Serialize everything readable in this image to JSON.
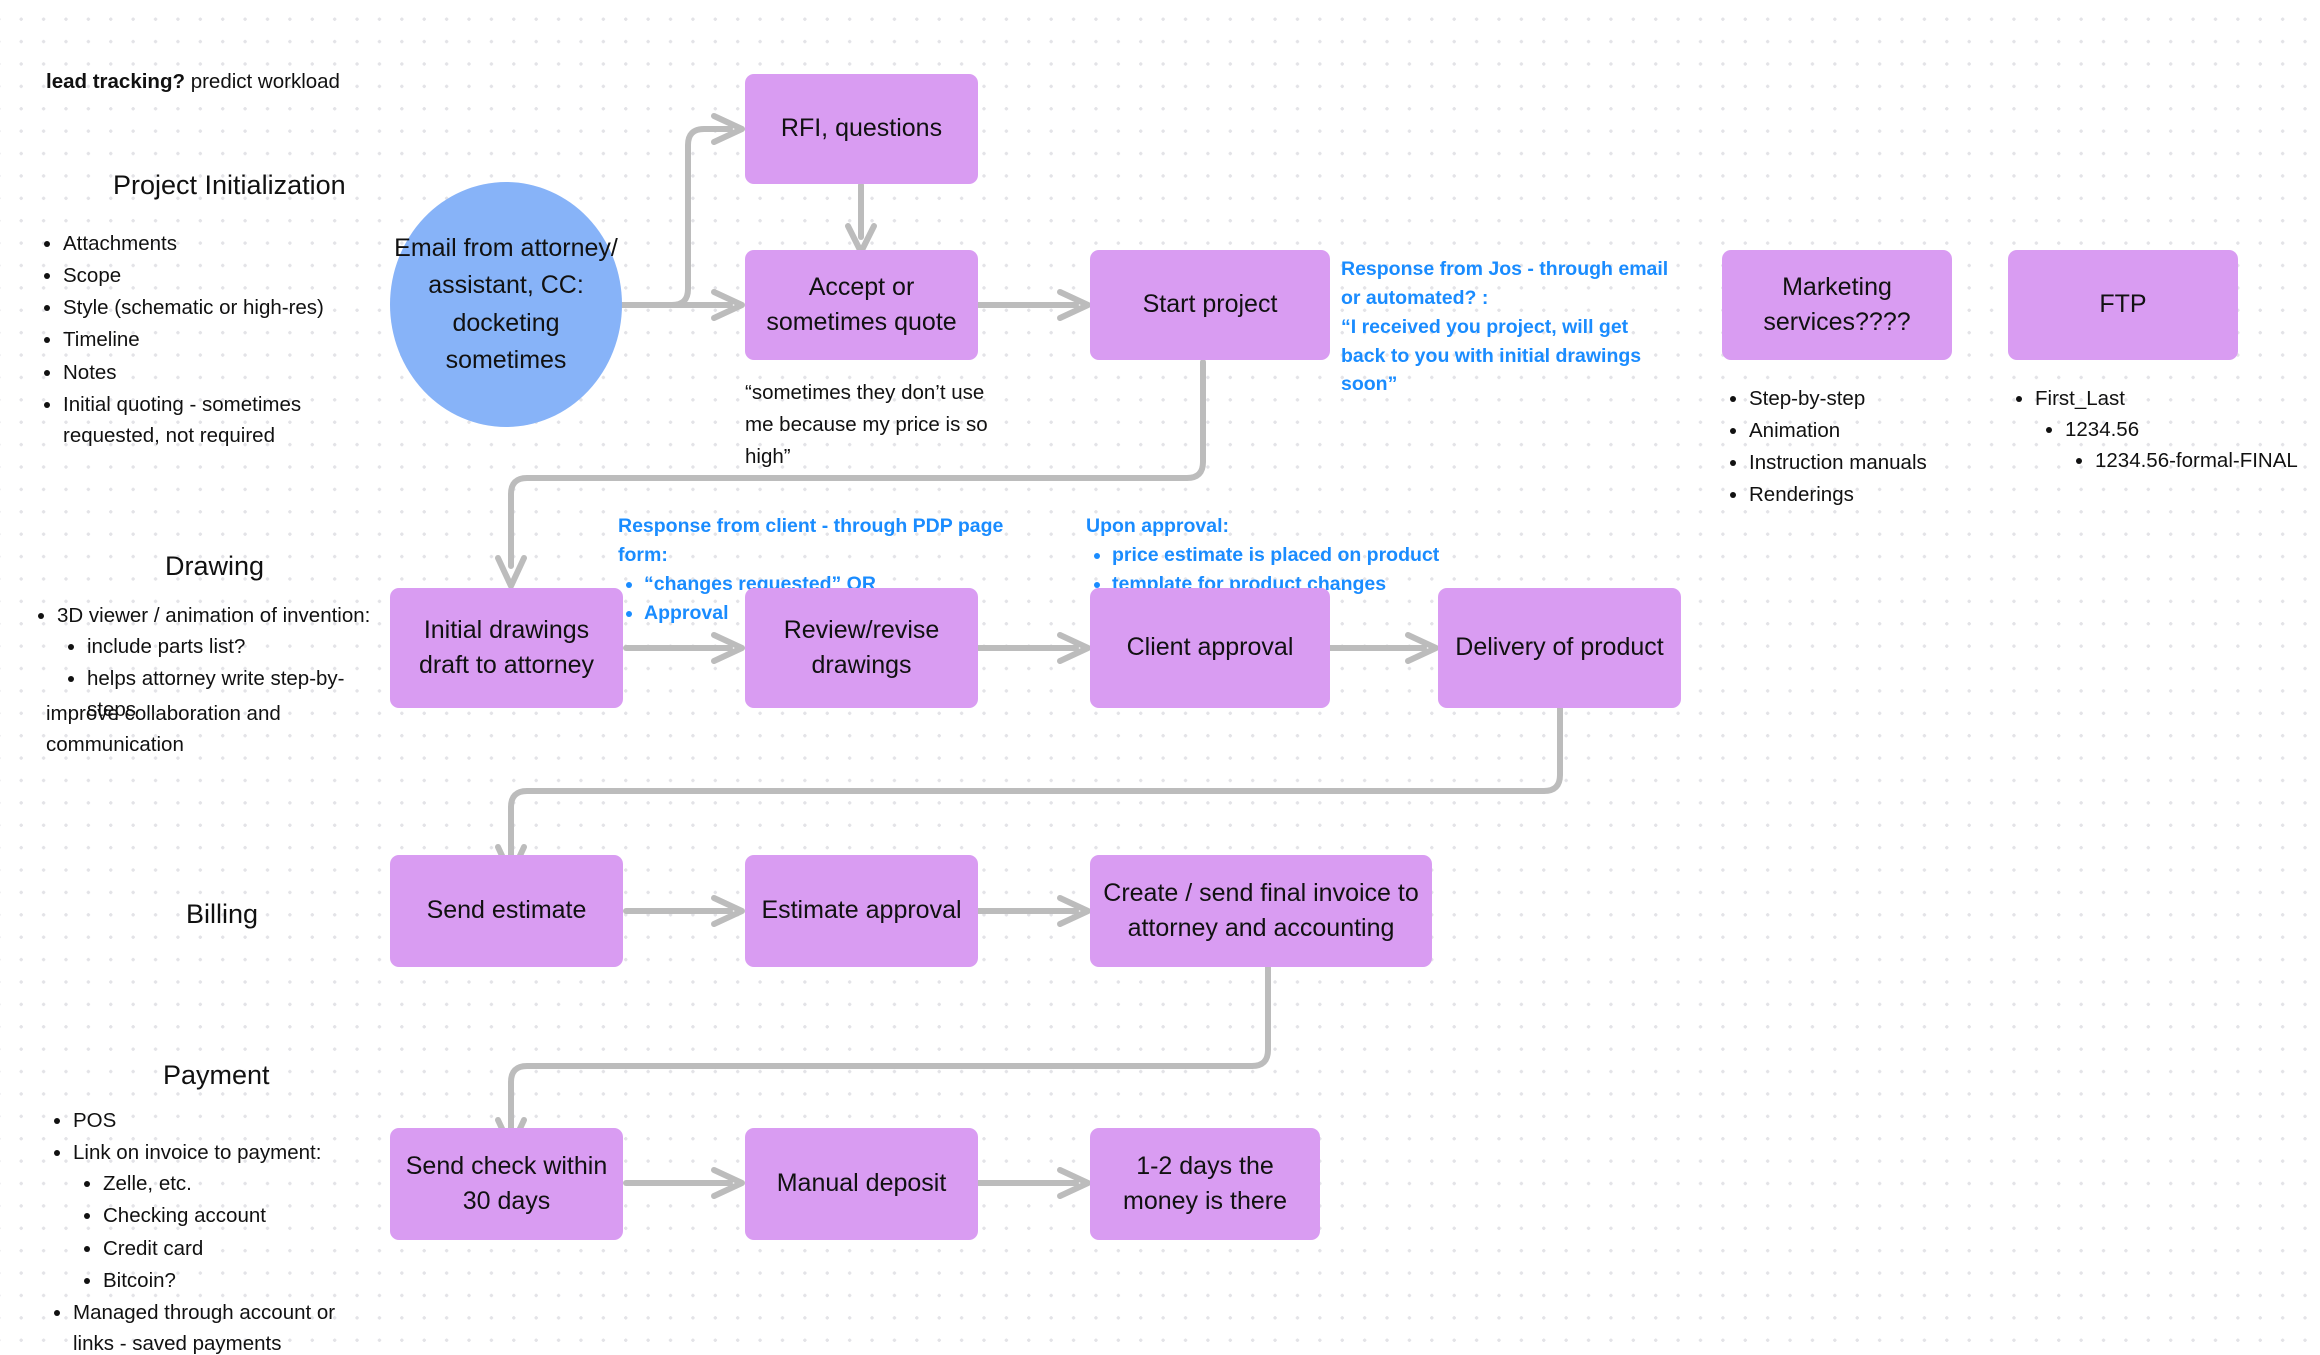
{
  "board": {
    "top_note_bold": "lead tracking?",
    "top_note_rest": " predict workload"
  },
  "sections": [
    {
      "title": "Project Initialization",
      "bullets": [
        "Attachments",
        "Scope",
        "Style (schematic or high-res)",
        "Timeline",
        "Notes",
        "Initial quoting - sometimes requested, not required"
      ]
    },
    {
      "title": "Drawing",
      "bullets": [
        "3D viewer / animation of invention:"
      ],
      "sub_bullets": [
        "include parts list?",
        "helps attorney write step-by-steps"
      ],
      "footer": "improve collaboration and communication"
    },
    {
      "title": "Billing"
    },
    {
      "title": "Payment",
      "bullets": [
        "POS",
        "Link on invoice to payment:"
      ],
      "sub_bullets": [
        "Zelle, etc.",
        "Checking account",
        "Credit card",
        "Bitcoin?"
      ],
      "last_bullet": "Managed through account or links - saved payments"
    }
  ],
  "nodes": {
    "email": "Email from attorney/ assistant, CC: docketing sometimes",
    "rfi": "RFI, questions",
    "accept": "Accept or sometimes quote",
    "start_project": "Start project",
    "marketing": "Marketing services????",
    "ftp": "FTP",
    "initial_drawings": "Initial drawings draft to attorney",
    "review_revise": "Review/revise drawings",
    "client_approval": "Client approval",
    "delivery": "Delivery of product",
    "send_estimate": "Send estimate",
    "estimate_approval": "Estimate approval",
    "final_invoice": "Create / send final invoice to attorney and accounting",
    "send_check": "Send check within 30 days",
    "manual_deposit": "Manual deposit",
    "money_there": "1-2 days the money is there"
  },
  "annotations": {
    "accept_quote": "“sometimes they don’t use me because my price is so high”",
    "jos_response_line1": "Response from Jos - through email or automated? :",
    "jos_response_line2": "“I received you project, will get back to you with initial drawings soon”",
    "client_response_title": "Response from client - through PDP page form:",
    "client_response_items": [
      "“changes requested” OR",
      "Approval"
    ],
    "upon_approval_title": "Upon approval:",
    "upon_approval_items": [
      "price estimate is placed on product",
      "template for product changes"
    ]
  },
  "lists": {
    "marketing": [
      "Step-by-step",
      "Animation",
      "Instruction manuals",
      "Renderings"
    ],
    "ftp_l1": "First_Last",
    "ftp_l2": "1234.56",
    "ftp_l3": "1234.56-formal-FINAL"
  },
  "colors": {
    "node_purple": "#d99cf2",
    "ellipse_blue": "#87b3f8",
    "annotation_blue": "#1a8cff",
    "wire_gray": "#bcbcbc"
  }
}
